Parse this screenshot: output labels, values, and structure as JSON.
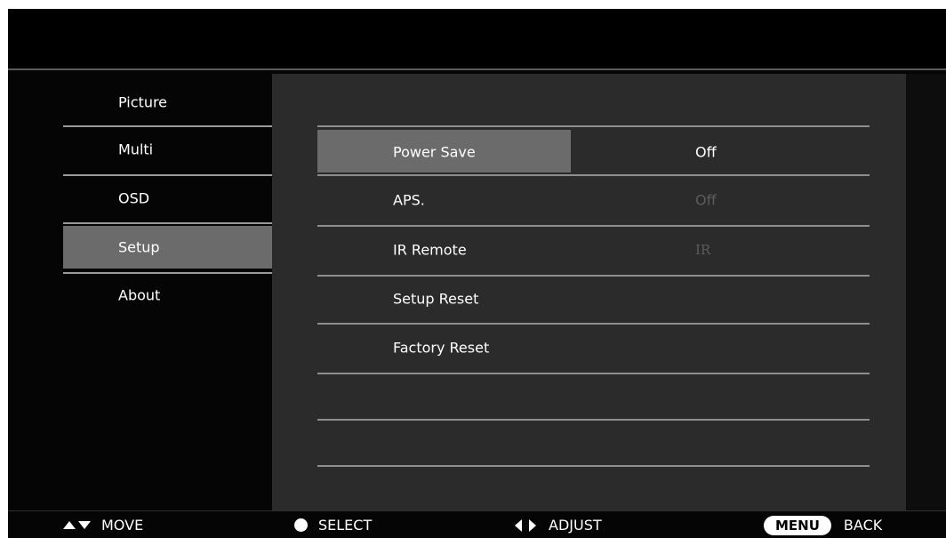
{
  "sidebar": {
    "items": [
      {
        "label": "Picture"
      },
      {
        "label": "Multi"
      },
      {
        "label": "OSD"
      },
      {
        "label": "Setup",
        "active": true
      },
      {
        "label": "About"
      }
    ]
  },
  "settings": {
    "rows": [
      {
        "name": "Power Save",
        "value": "Off",
        "selected": true
      },
      {
        "name": "APS.",
        "value": "Off",
        "dimmed": true
      },
      {
        "name": "IR Remote",
        "value": "IR",
        "dimmed": true
      },
      {
        "name": "Setup Reset",
        "value": ""
      },
      {
        "name": "Factory Reset",
        "value": ""
      }
    ]
  },
  "footer": {
    "move": "MOVE",
    "select": "SELECT",
    "adjust": "ADJUST",
    "menu_key": "MENU",
    "back": "BACK"
  },
  "colors": {
    "highlight": "#6b6b6b",
    "panel": "#2b2b2b",
    "background": "#050505",
    "dim_text": "#5c5c5c"
  }
}
